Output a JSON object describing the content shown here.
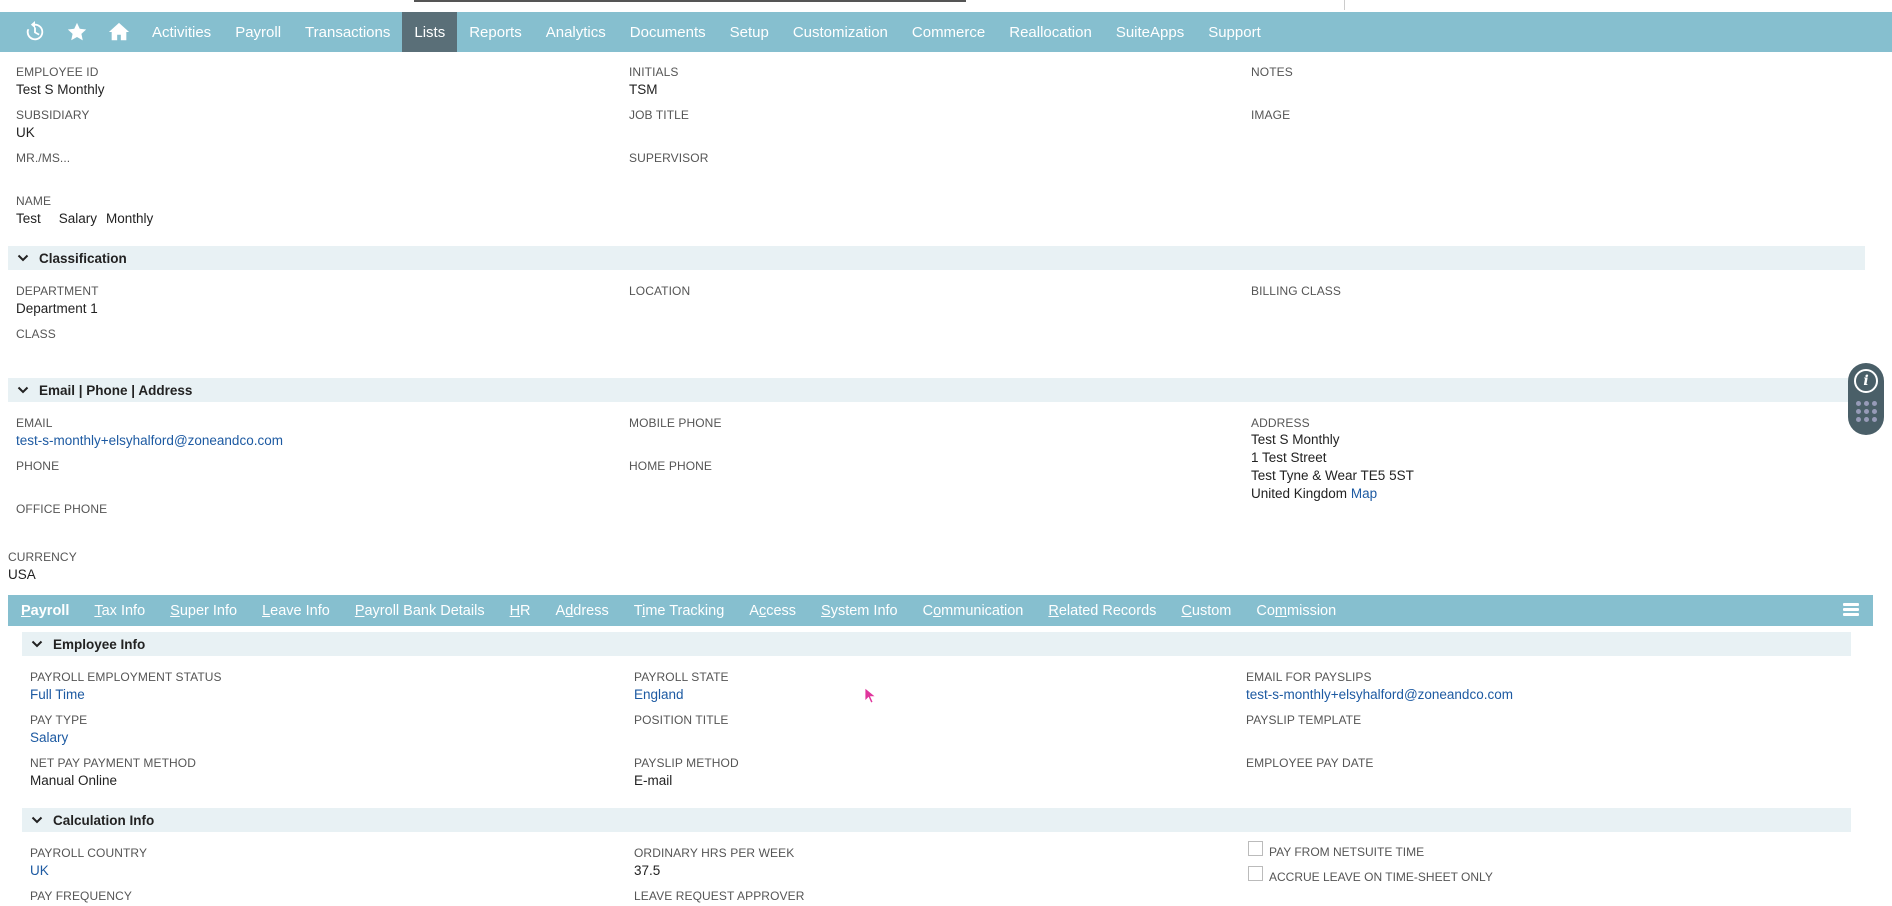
{
  "nav": {
    "icons": [
      "recent-icon",
      "star-icon",
      "home-icon"
    ],
    "items": [
      "Activities",
      "Payroll",
      "Transactions",
      "Lists",
      "Reports",
      "Analytics",
      "Documents",
      "Setup",
      "Customization",
      "Commerce",
      "Reallocation",
      "SuiteApps",
      "Support"
    ],
    "active": "Lists"
  },
  "primary": {
    "employee_id": {
      "label": "EMPLOYEE ID",
      "value": "Test S Monthly"
    },
    "initials": {
      "label": "INITIALS",
      "value": "TSM"
    },
    "notes": {
      "label": "NOTES",
      "value": ""
    },
    "subsidiary": {
      "label": "SUBSIDIARY",
      "value": "UK"
    },
    "job_title": {
      "label": "JOB TITLE",
      "value": ""
    },
    "image": {
      "label": "IMAGE",
      "value": ""
    },
    "salutation": {
      "label": "MR./MS...",
      "value": ""
    },
    "supervisor": {
      "label": "SUPERVISOR",
      "value": ""
    },
    "name": {
      "label": "NAME",
      "first": "Test",
      "middle": "Salary",
      "last": "Monthly"
    }
  },
  "classification": {
    "title": "Classification",
    "department": {
      "label": "DEPARTMENT",
      "value": "Department 1"
    },
    "location": {
      "label": "LOCATION",
      "value": ""
    },
    "billing_class": {
      "label": "BILLING CLASS",
      "value": ""
    },
    "class": {
      "label": "CLASS",
      "value": ""
    }
  },
  "contact": {
    "title": "Email | Phone | Address",
    "email": {
      "label": "EMAIL",
      "value": "test-s-monthly+elsyhalford@zoneandco.com"
    },
    "mobile_phone": {
      "label": "MOBILE PHONE",
      "value": ""
    },
    "address": {
      "label": "ADDRESS",
      "lines": [
        "Test S Monthly",
        "1 Test Street",
        "Test Tyne & Wear TE5 5ST",
        "United Kingdom"
      ],
      "map_link": "Map"
    },
    "phone": {
      "label": "PHONE",
      "value": ""
    },
    "home_phone": {
      "label": "HOME PHONE",
      "value": ""
    },
    "office_phone": {
      "label": "OFFICE PHONE",
      "value": ""
    }
  },
  "currency": {
    "label": "CURRENCY",
    "value": "USA"
  },
  "subtabs": {
    "items": [
      "Payroll",
      "Tax Info",
      "Super Info",
      "Leave Info",
      "Payroll Bank Details",
      "HR",
      "Address",
      "Time Tracking",
      "Access",
      "System Info",
      "Communication",
      "Related Records",
      "Custom",
      "Commission"
    ],
    "active": "Payroll"
  },
  "employee_info": {
    "title": "Employee Info",
    "employment_status": {
      "label": "PAYROLL EMPLOYMENT STATUS",
      "value": "Full Time"
    },
    "payroll_state": {
      "label": "PAYROLL STATE",
      "value": "England"
    },
    "email_for_payslips": {
      "label": "EMAIL FOR PAYSLIPS",
      "value": "test-s-monthly+elsyhalford@zoneandco.com"
    },
    "pay_type": {
      "label": "PAY TYPE",
      "value": "Salary"
    },
    "position_title": {
      "label": "POSITION TITLE",
      "value": ""
    },
    "payslip_template": {
      "label": "PAYSLIP TEMPLATE",
      "value": ""
    },
    "net_pay_method": {
      "label": "NET PAY PAYMENT METHOD",
      "value": "Manual Online"
    },
    "payslip_method": {
      "label": "PAYSLIP METHOD",
      "value": "E-mail"
    },
    "employee_pay_date": {
      "label": "EMPLOYEE PAY DATE",
      "value": ""
    }
  },
  "calculation_info": {
    "title": "Calculation Info",
    "payroll_country": {
      "label": "PAYROLL COUNTRY",
      "value": "UK"
    },
    "ordinary_hrs": {
      "label": "ORDINARY HRS PER WEEK",
      "value": "37.5"
    },
    "pay_from_netsuite": {
      "label": "PAY FROM NETSUITE TIME"
    },
    "accrue_leave": {
      "label": "ACCRUE LEAVE ON TIME-SHEET ONLY"
    },
    "pay_frequency": {
      "label": "PAY FREQUENCY",
      "value": ""
    },
    "leave_request_approver": {
      "label": "LEAVE REQUEST APPROVER",
      "value": ""
    }
  },
  "colors": {
    "nav_bg": "#86bfcf",
    "nav_active": "#5a6f78",
    "section_bg": "#e8f1f4",
    "link": "#1d5aa2"
  }
}
